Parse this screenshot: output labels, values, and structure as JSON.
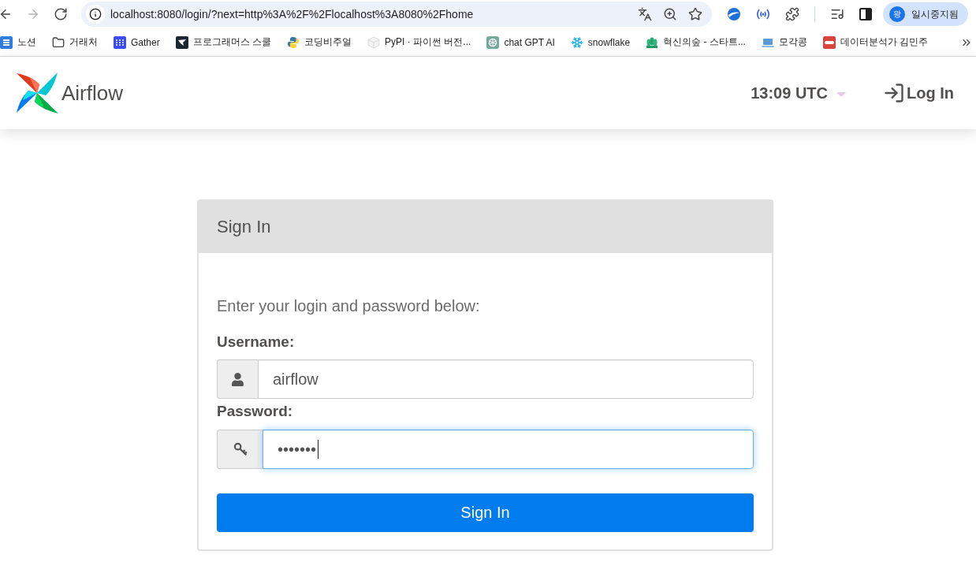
{
  "browser": {
    "nav_buttons": [
      {
        "kind": "back",
        "disabled": false
      },
      {
        "kind": "forward",
        "disabled": true
      },
      {
        "kind": "reload",
        "disabled": false
      }
    ],
    "address": "localhost:8080/login/?next=http%3A%2F%2Flocalhost%3A8080%2Fhome",
    "profile": {
      "avatar": "왕",
      "label": "일시중지됨"
    }
  },
  "bookmarks": [
    {
      "label": "노션",
      "kind": "card"
    },
    {
      "label": "거래처",
      "kind": "folder"
    },
    {
      "label": "Gather",
      "kind": "dots"
    },
    {
      "label": "프로그래머스 스쿨",
      "kind": "bird"
    },
    {
      "label": "코딩비주얼",
      "kind": "snake"
    },
    {
      "label": "PyPI · 파이썬 버전...",
      "kind": "cube"
    },
    {
      "label": "chat GPT AI",
      "kind": "knot"
    },
    {
      "label": "snowflake",
      "kind": "snowflake"
    },
    {
      "label": "혁신의숲 - 스타트...",
      "kind": "trees"
    },
    {
      "label": "모각콩",
      "kind": "laptop"
    },
    {
      "label": "데이터분석가 김민주",
      "kind": "badge"
    }
  ],
  "navbar": {
    "brand": "Airflow",
    "clock": "13:09 UTC",
    "login": "Log In"
  },
  "card": {
    "title": "Sign In",
    "instructions": "Enter your login and password below:",
    "fields": [
      {
        "label": "Username:",
        "kind": "user",
        "value": "airflow",
        "focused": false
      },
      {
        "label": "Password:",
        "kind": "password",
        "value": "•••••••",
        "focused": true
      }
    ],
    "button": "Sign In"
  }
}
